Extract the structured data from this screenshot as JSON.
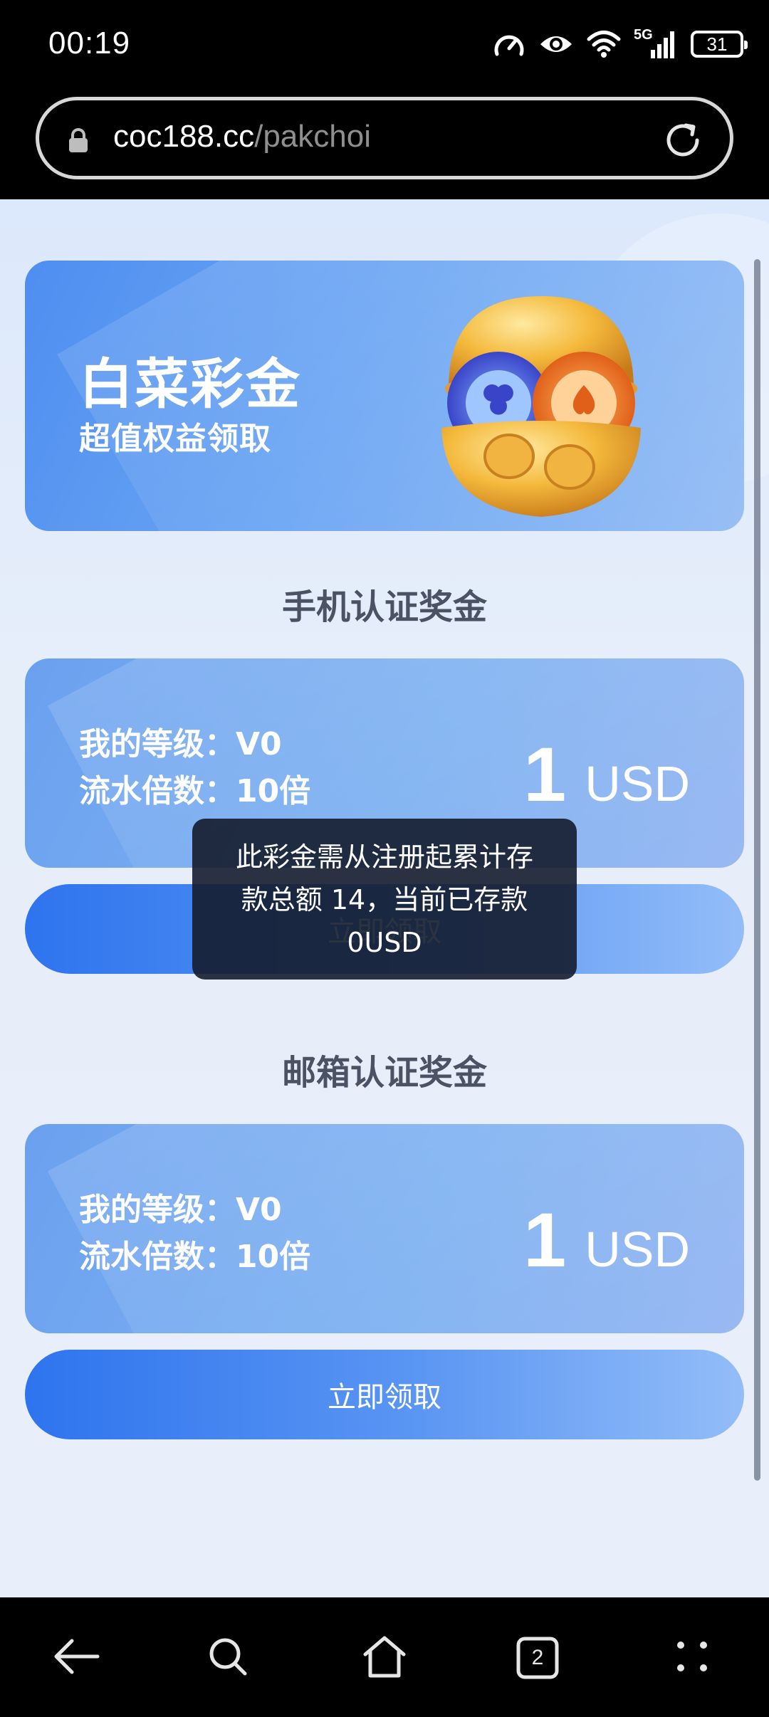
{
  "status_bar": {
    "time": "00:19",
    "network_label": "5G",
    "battery": "31",
    "icons": [
      "data-saver-icon",
      "eye-comfort-icon",
      "wifi-icon",
      "signal-icon",
      "battery-icon"
    ]
  },
  "browser": {
    "url_domain": "coc188.cc",
    "url_path": "/pakchoi",
    "tab_count": "2"
  },
  "banner": {
    "title": "白菜彩金",
    "subtitle": "超值权益领取"
  },
  "sections": [
    {
      "title": "手机认证奖金",
      "level_line": "我的等级：V0",
      "multiplier_line": "流水倍数：10倍",
      "amount": "1",
      "unit": "USD",
      "button_label": "立即领取"
    },
    {
      "title": "邮箱认证奖金",
      "level_line": "我的等级：V0",
      "multiplier_line": "流水倍数：10倍",
      "amount": "1",
      "unit": "USD",
      "button_label": "立即领取"
    }
  ],
  "toast": {
    "line1": "此彩金需从注册起累计存",
    "line2": "款总额 14，当前已存款",
    "line3": "0USD"
  },
  "colors": {
    "accent": "#2e74ee",
    "card": "#7fb2f1",
    "page_bg": "#e6eefa",
    "section_title": "#4a5264"
  }
}
